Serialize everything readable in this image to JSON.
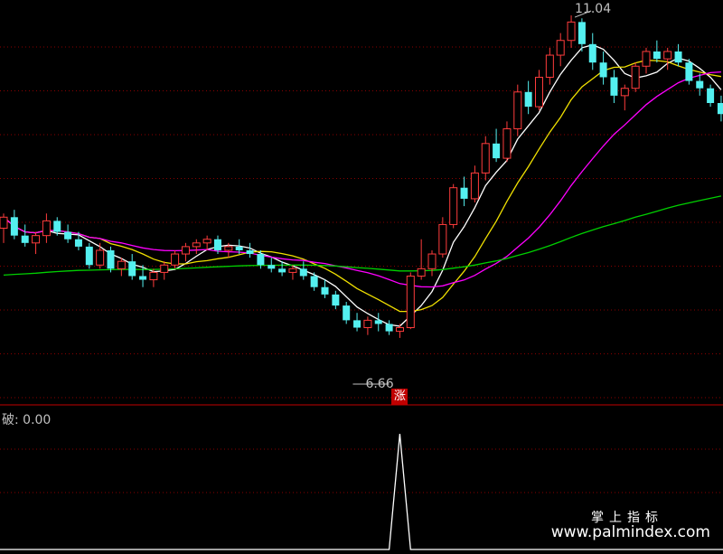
{
  "chart_data": {
    "type": "candlestick",
    "price_range": [
      5.8,
      11.2
    ],
    "up_color": "#ff3c3c",
    "down_color": "#54f0f0",
    "high_label": "11.04",
    "low_label": "6.66",
    "signal_label": "涨",
    "moving_averages": [
      {
        "color": "#ffffff"
      },
      {
        "color": "#f0e000"
      },
      {
        "color": "#ff00ff"
      },
      {
        "color": "#00d000"
      }
    ],
    "ohlc": [
      [
        8.15,
        8.35,
        7.95,
        8.3
      ],
      [
        8.3,
        8.4,
        8.0,
        8.05
      ],
      [
        8.05,
        8.2,
        7.9,
        7.95
      ],
      [
        7.95,
        8.1,
        7.8,
        8.05
      ],
      [
        8.05,
        8.35,
        7.95,
        8.25
      ],
      [
        8.25,
        8.3,
        8.05,
        8.1
      ],
      [
        8.1,
        8.2,
        7.95,
        8.0
      ],
      [
        8.0,
        8.1,
        7.85,
        7.9
      ],
      [
        7.9,
        7.95,
        7.6,
        7.65
      ],
      [
        7.65,
        7.95,
        7.6,
        7.85
      ],
      [
        7.85,
        7.9,
        7.55,
        7.6
      ],
      [
        7.6,
        7.75,
        7.5,
        7.7
      ],
      [
        7.7,
        7.8,
        7.45,
        7.5
      ],
      [
        7.5,
        7.65,
        7.35,
        7.45
      ],
      [
        7.45,
        7.6,
        7.35,
        7.55
      ],
      [
        7.55,
        7.7,
        7.45,
        7.65
      ],
      [
        7.65,
        7.85,
        7.6,
        7.8
      ],
      [
        7.8,
        7.95,
        7.7,
        7.9
      ],
      [
        7.9,
        8.0,
        7.8,
        7.95
      ],
      [
        7.95,
        8.05,
        7.85,
        8.0
      ],
      [
        8.0,
        8.05,
        7.8,
        7.85
      ],
      [
        7.85,
        7.95,
        7.75,
        7.9
      ],
      [
        7.9,
        8.0,
        7.8,
        7.85
      ],
      [
        7.85,
        7.95,
        7.75,
        7.8
      ],
      [
        7.8,
        7.85,
        7.6,
        7.65
      ],
      [
        7.65,
        7.75,
        7.55,
        7.6
      ],
      [
        7.6,
        7.7,
        7.5,
        7.55
      ],
      [
        7.55,
        7.65,
        7.45,
        7.6
      ],
      [
        7.6,
        7.7,
        7.45,
        7.5
      ],
      [
        7.5,
        7.55,
        7.3,
        7.35
      ],
      [
        7.35,
        7.45,
        7.2,
        7.25
      ],
      [
        7.25,
        7.3,
        7.05,
        7.1
      ],
      [
        7.1,
        7.15,
        6.85,
        6.9
      ],
      [
        6.9,
        7.0,
        6.75,
        6.8
      ],
      [
        6.8,
        6.95,
        6.7,
        6.9
      ],
      [
        6.9,
        7.0,
        6.75,
        6.85
      ],
      [
        6.85,
        6.9,
        6.7,
        6.75
      ],
      [
        6.75,
        6.85,
        6.66,
        6.8
      ],
      [
        6.8,
        7.55,
        6.78,
        7.5
      ],
      [
        7.5,
        8.0,
        7.45,
        7.6
      ],
      [
        7.6,
        7.85,
        7.5,
        7.8
      ],
      [
        7.8,
        8.3,
        7.75,
        8.2
      ],
      [
        8.2,
        8.75,
        8.15,
        8.7
      ],
      [
        8.7,
        8.85,
        8.45,
        8.55
      ],
      [
        8.55,
        9.0,
        8.5,
        8.9
      ],
      [
        8.9,
        9.4,
        8.8,
        9.3
      ],
      [
        9.3,
        9.5,
        9.05,
        9.1
      ],
      [
        9.1,
        9.6,
        9.05,
        9.5
      ],
      [
        9.5,
        10.1,
        9.4,
        10.0
      ],
      [
        10.0,
        10.15,
        9.7,
        9.8
      ],
      [
        9.8,
        10.3,
        9.75,
        10.2
      ],
      [
        10.2,
        10.6,
        10.1,
        10.5
      ],
      [
        10.5,
        10.8,
        10.35,
        10.7
      ],
      [
        10.7,
        11.04,
        10.6,
        10.95
      ],
      [
        10.95,
        11.0,
        10.55,
        10.65
      ],
      [
        10.65,
        10.8,
        10.3,
        10.4
      ],
      [
        10.4,
        10.55,
        10.1,
        10.2
      ],
      [
        10.2,
        10.3,
        9.85,
        9.95
      ],
      [
        9.95,
        10.1,
        9.75,
        10.05
      ],
      [
        10.05,
        10.4,
        10.0,
        10.35
      ],
      [
        10.35,
        10.6,
        10.25,
        10.55
      ],
      [
        10.55,
        10.7,
        10.4,
        10.45
      ],
      [
        10.45,
        10.6,
        10.3,
        10.55
      ],
      [
        10.55,
        10.65,
        10.35,
        10.4
      ],
      [
        10.4,
        10.45,
        10.1,
        10.15
      ],
      [
        10.15,
        10.25,
        9.95,
        10.05
      ],
      [
        10.05,
        10.1,
        9.8,
        9.85
      ],
      [
        9.85,
        9.95,
        9.6,
        9.7
      ]
    ],
    "indicator": {
      "label": "破: 0.00",
      "range": [
        0,
        1
      ],
      "values": [
        0,
        0,
        0,
        0,
        0,
        0,
        0,
        0,
        0,
        0,
        0,
        0,
        0,
        0,
        0,
        0,
        0,
        0,
        0,
        0,
        0,
        0,
        0,
        0,
        0,
        0,
        0,
        0,
        0,
        0,
        0,
        0,
        0,
        0,
        0,
        0,
        0,
        1,
        0,
        0,
        0,
        0,
        0,
        0,
        0,
        0,
        0,
        0,
        0,
        0,
        0,
        0,
        0,
        0,
        0,
        0,
        0,
        0,
        0,
        0,
        0,
        0,
        0,
        0,
        0,
        0,
        0,
        0
      ]
    }
  },
  "watermark": {
    "cn": "掌上指标",
    "url": "www.palmindex.com"
  }
}
